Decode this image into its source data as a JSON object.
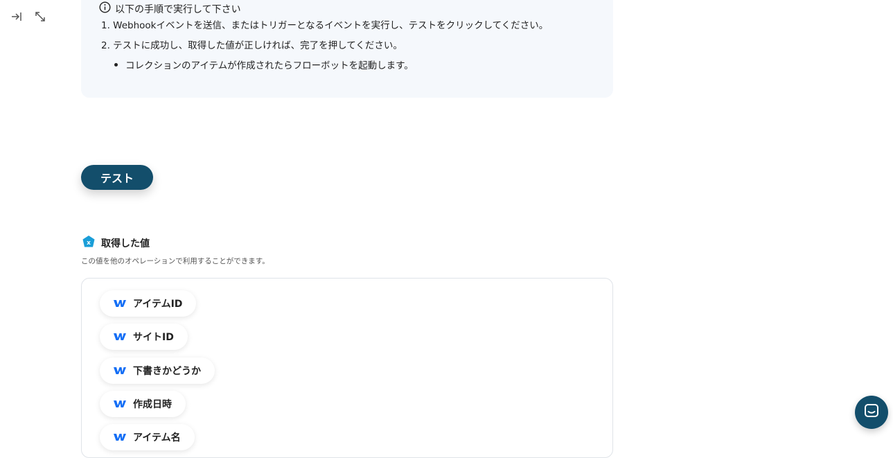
{
  "toolbar": {
    "icons": [
      "collapse-right-icon",
      "expand-icon"
    ]
  },
  "instructions": {
    "heading": "以下の手順で実行して下さい",
    "steps": [
      "1. Webhookイベントを送信、またはトリガーとなるイベントを実行し、テストをクリックしてください。",
      "2. テストに成功し、取得した値が正しければ、完了を押してください。"
    ],
    "bullet": "コレクションのアイテムが作成されたらフローボットを起動します。"
  },
  "test_button": {
    "label": "テスト",
    "color": "#134e6b"
  },
  "values_section": {
    "title": "取得した値",
    "description": "この値を他のオペレーションで利用することができます。",
    "items": [
      {
        "label": "アイテムID",
        "icon": "webflow-icon"
      },
      {
        "label": "サイトID",
        "icon": "webflow-icon"
      },
      {
        "label": "下書きかどうか",
        "icon": "webflow-icon"
      },
      {
        "label": "作成日時",
        "icon": "webflow-icon"
      },
      {
        "label": "アイテム名",
        "icon": "webflow-icon"
      }
    ]
  },
  "colors": {
    "accent": "#134e6b",
    "webflow": "#146ef5",
    "info_bg": "#f5f8fc"
  }
}
